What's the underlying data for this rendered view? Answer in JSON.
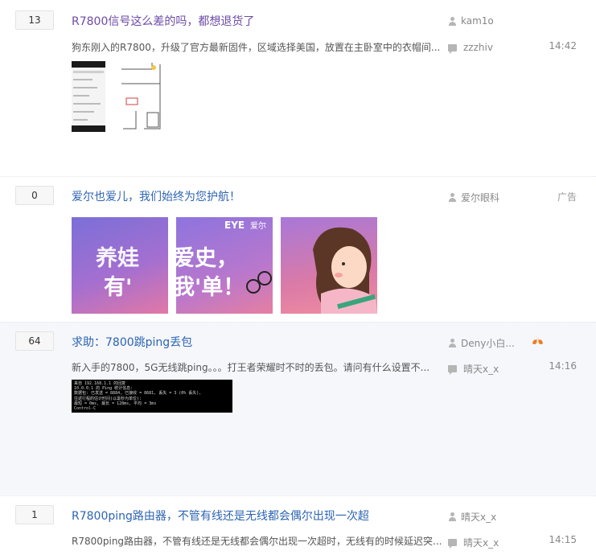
{
  "posts": [
    {
      "reply_count": "13",
      "title": "R7800信号这么差的吗，都想退货了",
      "snippet": "狗东刚入的R7800，升级了官方最新固件，区域选择美国，放置在主卧室中的衣帽间...",
      "author": "kam1o",
      "last_replier": "zzzhiv",
      "time": "14:42",
      "images": [
        "phone-screenshot",
        "hand-drawn-floorplan"
      ]
    },
    {
      "reply_count": "0",
      "title": "爱尔也爱儿，我们始终为您护航！",
      "author": "爱尔眼科",
      "ad_label": "广告",
      "images": [
        "ad-banner-1",
        "ad-banner-2",
        "ad-banner-3"
      ],
      "banner_text_1": "养娃爱史，",
      "banner_text_2": "有'我'单！",
      "banner_logo": "EYE 爱尔"
    },
    {
      "reply_count": "64",
      "title": "求助：7800跳ping丢包",
      "snippet": "新入手的7800，5G无线跳ping。。。打王者荣耀时不时的丢包。请问有什么设置不...",
      "author": "Deny小白...",
      "last_replier": "晴天x_x",
      "time": "14:16",
      "images": [
        "cmd-ping-screenshot"
      ],
      "cmd_lines": [
        "来自 192.168.1.1 的回复",
        "10.0.0.1 的 Ping 统计信息:",
        "    数据包: 已发送 = 8884, 已接收 = 8681, 丢失 = 3 (0% 丢失),",
        "往返行程的估计时间(以毫秒为单位):",
        "    最短 = 0ms, 最长 = 128ms, 平均 = 3ms",
        "Control-C"
      ]
    },
    {
      "reply_count": "1",
      "title": "R7800ping路由器，不管有线还是无线都会偶尔出现一次超",
      "snippet": "R7800ping路由器，不管有线还是无线都会偶尔出现一次超时，无线有的时候延迟突...",
      "author": "晴天x_x",
      "last_replier": "晴天x_x",
      "time": "14:15"
    }
  ],
  "colors": {
    "title_link": "#2d64b3",
    "title_visited": "#6c4ba6",
    "meta_gray": "#888888",
    "highlight_bg": "#f5f7fb",
    "banner_gradient_start": "#7b6fd8",
    "banner_gradient_end": "#e278a6"
  }
}
